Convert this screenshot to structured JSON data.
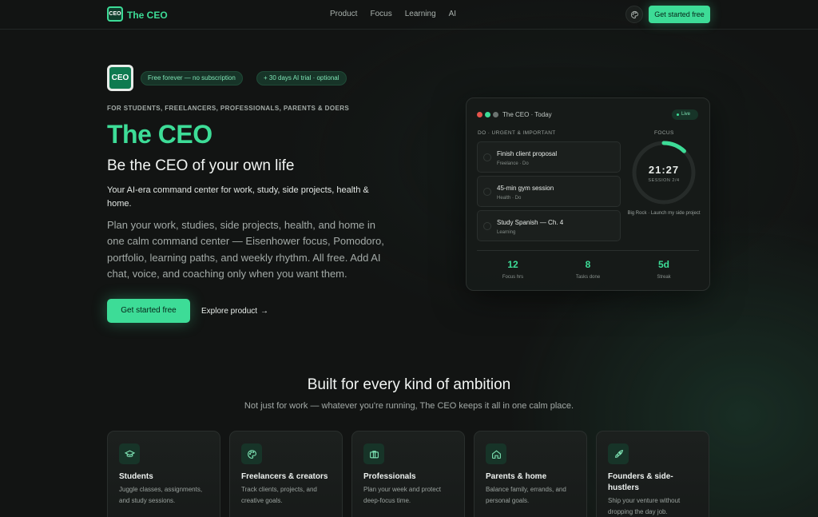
{
  "nav": {
    "logo_text": "CEO",
    "brand": "The CEO",
    "links": [
      "Product",
      "Focus",
      "Learning",
      "AI"
    ],
    "cta": "Get started free",
    "palette_icon": "palette-icon"
  },
  "hero": {
    "logo_text": "CEO",
    "pills": [
      "Free forever — no subscription",
      "+ 30 days AI trial · optional"
    ],
    "eyebrow": "FOR STUDENTS, FREELANCERS, PROFESSIONALS, PARENTS & DOERS",
    "title": "The CEO",
    "subtitle": "Be the CEO of your own life",
    "tagline": "Your AI-era command center for work, study, side projects, health & home.",
    "description": "Plan your work, studies, side projects, health, and home in one calm command center — Eisenhower focus, Pomodoro, portfolio, learning paths, and weekly rhythm. All free. Add AI chat, voice, and coaching only when you want them.",
    "primary_cta": "Get started free",
    "secondary_cta": "Explore product",
    "secondary_icon": "arrow-right-icon"
  },
  "dashboard": {
    "title": "The CEO · Today",
    "live": "Live",
    "quadrant_label": "DO · URGENT & IMPORTANT",
    "focus_label": "FOCUS",
    "tasks": [
      {
        "title": "Finish client proposal",
        "meta": "Freelance · Do"
      },
      {
        "title": "45-min gym session",
        "meta": "Health · Do"
      },
      {
        "title": "Study Spanish — Ch. 4",
        "meta": "Learning"
      }
    ],
    "timer": "21:27",
    "session": "SESSION 2/4",
    "big_rock": "Big Rock · Launch my side project",
    "stats": [
      {
        "value": "12",
        "label": "Focus hrs"
      },
      {
        "value": "8",
        "label": "Tasks done"
      },
      {
        "value": "5d",
        "label": "Streak"
      }
    ],
    "colors": {
      "accent": "#3ddc97",
      "dot_red": "#e5534b",
      "dot_green": "#3ddc97",
      "dot_gray": "#6b7370"
    }
  },
  "audience": {
    "title": "Built for every kind of ambition",
    "subtitle": "Not just for work — whatever you're running, The CEO keeps it all in one calm place.",
    "cards": [
      {
        "icon": "graduation-cap-icon",
        "title": "Students",
        "desc": "Juggle classes, assignments, and study sessions."
      },
      {
        "icon": "palette-icon",
        "title": "Freelancers & creators",
        "desc": "Track clients, projects, and creative goals."
      },
      {
        "icon": "briefcase-icon",
        "title": "Professionals",
        "desc": "Plan your week and protect deep-focus time."
      },
      {
        "icon": "home-icon",
        "title": "Parents & home",
        "desc": "Balance family, errands, and personal goals."
      },
      {
        "icon": "rocket-icon",
        "title": "Founders & side-hustlers",
        "desc": "Ship your venture without dropping the day job."
      }
    ]
  }
}
